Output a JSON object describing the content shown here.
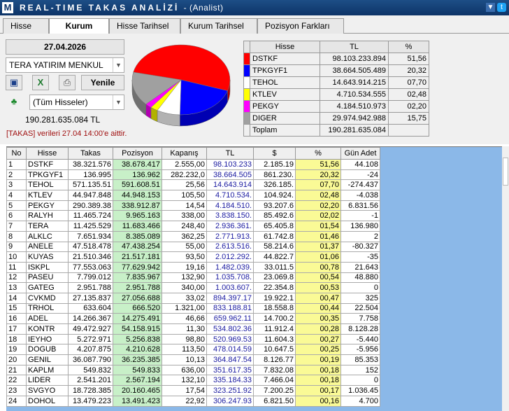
{
  "app": {
    "title": "REAL-TIME TAKAS ANALİZİ",
    "subtitle": "- (Analist)"
  },
  "tabs": [
    "Hisse",
    "Kurum",
    "Hisse Tarihsel",
    "Kurum Tarihsel",
    "Pozisyon Farkları"
  ],
  "active_tab": "Kurum",
  "controls": {
    "date": "27.04.2026",
    "broker": "TERA YATIRIM MENKUL",
    "filter": "(Tüm Hisseler)",
    "refresh": "Yenile",
    "total": "190.281.635.084 TL",
    "note": "[TAKAS] verileri 27.04 14:00'e aittir."
  },
  "legend_table": {
    "headers": [
      "Hisse",
      "TL",
      "%"
    ],
    "rows": [
      {
        "name": "DSTKF",
        "tl": "98.103.233.894",
        "pct": "51,56",
        "color": "#ff0000"
      },
      {
        "name": "TPKGYF1",
        "tl": "38.664.505.489",
        "pct": "20,32",
        "color": "#0000ff"
      },
      {
        "name": "TEHOL",
        "tl": "14.643.914.215",
        "pct": "07,70",
        "color": "#ffffff"
      },
      {
        "name": "KTLEV",
        "tl": "4.710.534.555",
        "pct": "02,48",
        "color": "#ffff00"
      },
      {
        "name": "PEKGY",
        "tl": "4.184.510.973",
        "pct": "02,20",
        "color": "#ff00ff"
      },
      {
        "name": "DIGER",
        "tl": "29.974.942.988",
        "pct": "15,75",
        "color": "#a0a0a0"
      }
    ],
    "total_label": "Toplam",
    "total_value": "190.281.635.084"
  },
  "chart_data": {
    "type": "pie",
    "categories": [
      "DSTKF",
      "TPKGYF1",
      "TEHOL",
      "KTLEV",
      "PEKGY",
      "DIGER"
    ],
    "values": [
      51.56,
      20.32,
      7.7,
      2.48,
      2.2,
      15.75
    ]
  },
  "grid": {
    "headers": [
      "No",
      "Hisse",
      "Takas",
      "Pozisyon",
      "Kapanış",
      "TL",
      "$",
      "%",
      "Gün Adet"
    ],
    "rows": [
      [
        "1",
        "DSTKF",
        "38.321.576",
        "38.678.417",
        "2.555,00",
        "98.103.233",
        "2.185.19",
        "51,56",
        "44.108"
      ],
      [
        "2",
        "TPKGYF1",
        "136.995",
        "136.962",
        "282.232,0",
        "38.664.505",
        "861.230.",
        "20,32",
        "-24"
      ],
      [
        "3",
        "TEHOL",
        "571.135.51",
        "591.608.51",
        "25,56",
        "14.643.914",
        "326.185.",
        "07,70",
        "-274.437"
      ],
      [
        "4",
        "KTLEV",
        "44.947.848",
        "44.948.153",
        "105,50",
        "4.710.534.",
        "104.924.",
        "02,48",
        "-4.038"
      ],
      [
        "5",
        "PEKGY",
        "290.389.38",
        "338.912.87",
        "14,54",
        "4.184.510.",
        "93.207.6",
        "02,20",
        "6.831.56"
      ],
      [
        "6",
        "RALYH",
        "11.465.724",
        "9.965.163",
        "338,00",
        "3.838.150.",
        "85.492.6",
        "02,02",
        "-1"
      ],
      [
        "7",
        "TERA",
        "11.425.529",
        "11.683.466",
        "248,40",
        "2.936.361.",
        "65.405.8",
        "01,54",
        "136.980"
      ],
      [
        "8",
        "ALKLC",
        "7.651.934",
        "8.385.089",
        "362,25",
        "2.771.913.",
        "61.742.8",
        "01,46",
        "2"
      ],
      [
        "9",
        "ANELE",
        "47.518.478",
        "47.438.254",
        "55,00",
        "2.613.516.",
        "58.214.6",
        "01,37",
        "-80.327"
      ],
      [
        "10",
        "KUYAS",
        "21.510.346",
        "21.517.181",
        "93,50",
        "2.012.292.",
        "44.822.7",
        "01,06",
        "-35"
      ],
      [
        "11",
        "ISKPL",
        "77.553.063",
        "77.629.942",
        "19,16",
        "1.482.039.",
        "33.011.5",
        "00,78",
        "21.643"
      ],
      [
        "12",
        "PASEU",
        "7.799.012",
        "7.835.967",
        "132,90",
        "1.035.708.",
        "23.069.8",
        "00,54",
        "48.880"
      ],
      [
        "13",
        "GATEG",
        "2.951.788",
        "2.951.788",
        "340,00",
        "1.003.607.",
        "22.354.8",
        "00,53",
        "0"
      ],
      [
        "14",
        "CVKMD",
        "27.135.837",
        "27.056.688",
        "33,02",
        "894.397.17",
        "19.922.1",
        "00,47",
        "325"
      ],
      [
        "15",
        "TRHOL",
        "633.604",
        "666.520",
        "1.321,00",
        "833.188.81",
        "18.558.8",
        "00,44",
        "22.504"
      ],
      [
        "16",
        "ADEL",
        "14.266.367",
        "14.275.491",
        "46,66",
        "659.962.11",
        "14.700.2",
        "00,35",
        "7.758"
      ],
      [
        "17",
        "KONTR",
        "49.472.927",
        "54.158.915",
        "11,30",
        "534.802.36",
        "11.912.4",
        "00,28",
        "8.128.28"
      ],
      [
        "18",
        "IEYHO",
        "5.272.971",
        "5.256.838",
        "98,80",
        "520.969.53",
        "11.604.3",
        "00,27",
        "-5.440"
      ],
      [
        "19",
        "DOGUB",
        "4.207.875",
        "4.210.628",
        "113,50",
        "478.014.59",
        "10.647.5",
        "00,25",
        "-5.956"
      ],
      [
        "20",
        "GENIL",
        "36.087.790",
        "36.235.385",
        "10,13",
        "364.847.54",
        "8.126.77",
        "00,19",
        "85.353"
      ],
      [
        "21",
        "KAPLM",
        "549.832",
        "549.833",
        "636,00",
        "351.617.35",
        "7.832.08",
        "00,18",
        "152"
      ],
      [
        "22",
        "LIDER",
        "2.541.201",
        "2.567.194",
        "132,10",
        "335.184.33",
        "7.466.04",
        "00,18",
        "0"
      ],
      [
        "23",
        "SVGYO",
        "18.728.385",
        "20.160.465",
        "17,54",
        "323.251.92",
        "7.200.25",
        "00,17",
        "1.036.45"
      ],
      [
        "24",
        "DOHOL",
        "13.479.223",
        "13.491.423",
        "22,92",
        "306.247.93",
        "6.821.50",
        "00,16",
        "4.700"
      ]
    ]
  }
}
